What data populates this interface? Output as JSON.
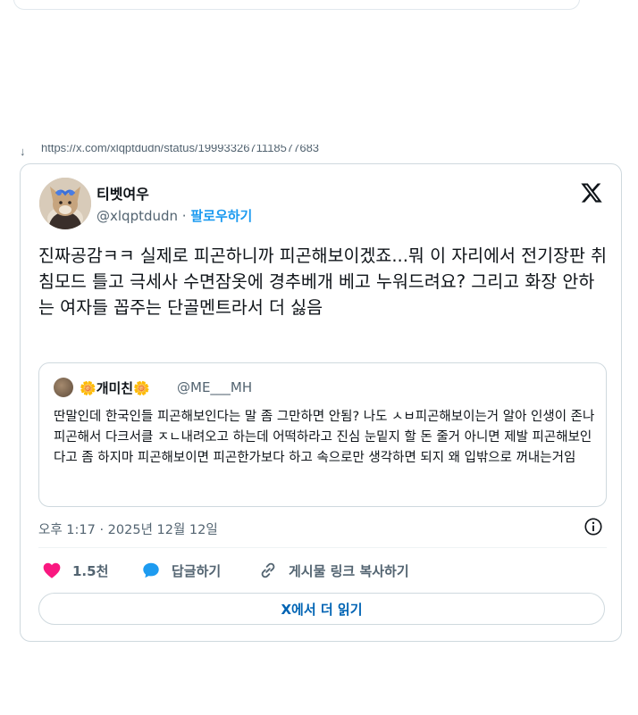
{
  "link": {
    "arrow": "↓",
    "url": "https://x.com/xlqptdudn/status/1999332671118577683"
  },
  "tweet": {
    "author_name": "티벳여우",
    "handle": "@xlqptdudn",
    "separator": " · ",
    "follow_label": "팔로우하기",
    "text": "진짜공감ㅋㅋ 실제로 피곤하니까 피곤해보이겠죠...뭐 이 자리에서 전기장판 취침모드 틀고 극세사 수면잠옷에 경추베개 베고 누워드려요? 그리고 화장 안하는 여자들 꼽주는 단골멘트라서 더 싫음",
    "timestamp": "오후 1:17 · 2025년 12월 12일"
  },
  "quote": {
    "name_prefix_emoji": "🌼",
    "name": "개미친",
    "name_suffix_emoji": "🌼",
    "handle": "@ME___MH",
    "text": "딴말인데 한국인들 피곤해보인다는 말 좀 그만하면 안됨? 나도 ㅅㅂ피곤해보이는거 알아 인생이 존나 피곤해서 다크서클 ㅈㄴ내려오고 하는데 어떡하라고 진심 눈밑지 할 돈 줄거 아니면 제발 피곤해보인다고 좀 하지마 피곤해보이면 피곤한가보다 하고 속으로만 생각하면 되지 왜 입밖으로 꺼내는거임"
  },
  "actions": {
    "like_count": "1.5천",
    "reply_label": "답글하기",
    "copy_link_label": "게시물 링크 복사하기"
  },
  "read_more_label": "X에서 더 읽기",
  "icons": {
    "like": "heart-icon",
    "reply": "speech-bubble-icon",
    "copy": "link-icon",
    "info": "info-icon",
    "brand": "x-logo-icon"
  },
  "colors": {
    "accent": "#1d9bf0",
    "like": "#f91880",
    "text": "#0f1419",
    "muted": "#536471",
    "border": "#cfd9de"
  }
}
